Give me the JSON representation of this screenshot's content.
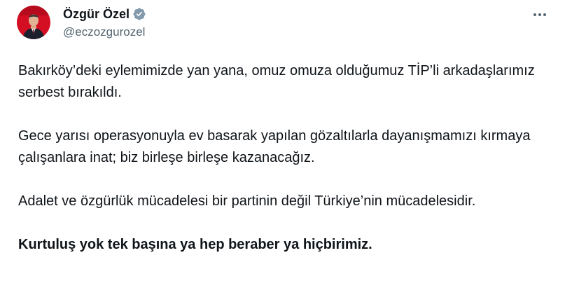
{
  "author": {
    "display_name": "Özgür Özel",
    "handle": "@eczozgurozel",
    "verified": true
  },
  "icons": {
    "verified": "verified-badge-icon",
    "more": "more-horizontal-icon"
  },
  "colors": {
    "verified_badge": "#829aab",
    "secondary_text": "#536471",
    "primary_text": "#0f1419",
    "avatar_background": "#d40f24"
  },
  "tweet": {
    "paragraphs": [
      "Bakırköy’deki eylemimizde yan yana, omuz omuza olduğumuz TİP’li arkadaşlarımız serbest bırakıldı.",
      "Gece yarısı operasyonuyla ev basarak yapılan gözaltılarla dayanışmamızı kırmaya çalışanlara inat; biz birleşe birleşe kazanacağız.",
      "Adalet ve özgürlük mücadelesi bir partinin değil Türkiye’nin mücadelesidir.",
      "Kurtuluş yok tek başına ya hep beraber ya hiçbirimiz."
    ]
  }
}
